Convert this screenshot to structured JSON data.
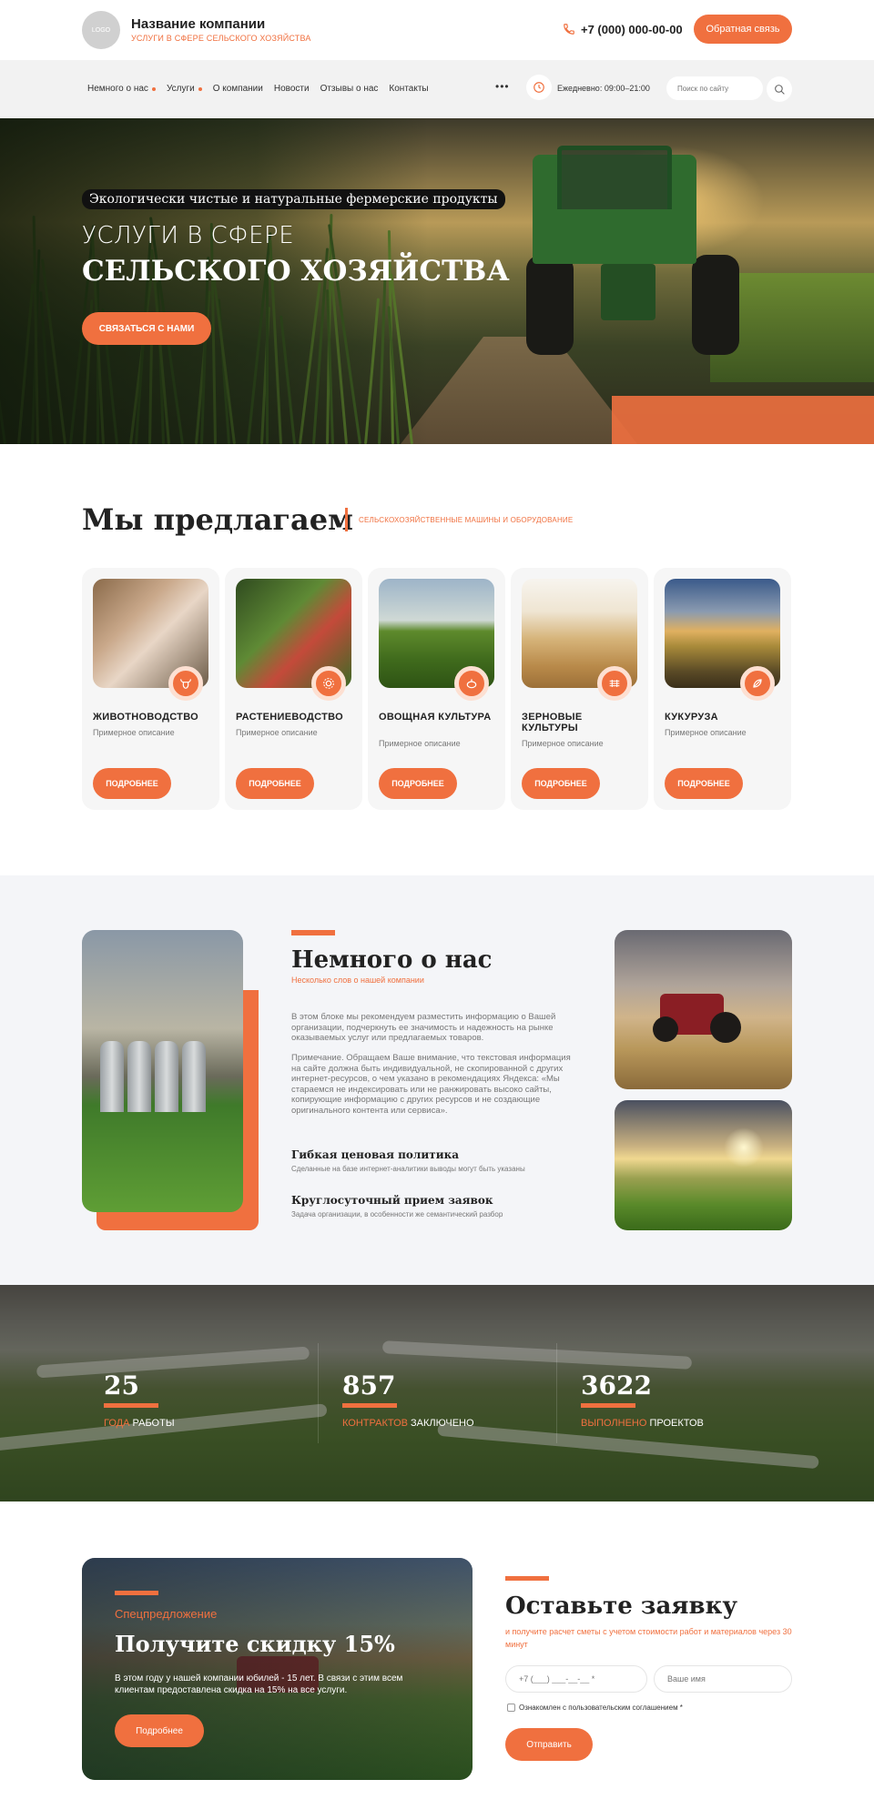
{
  "header": {
    "logo_text": "LOGO",
    "company_name": "Название компании",
    "tagline": "УСЛУГИ В СФЕРЕ СЕЛЬСКОГО ХОЗЯЙСТВА",
    "phone": "+7 (000) 000-00-00",
    "callback_label": "Обратная связь"
  },
  "nav": {
    "items": [
      {
        "label": "Немного о нас",
        "has_dropdown": true
      },
      {
        "label": "Услуги",
        "has_dropdown": true
      },
      {
        "label": "О компании",
        "has_dropdown": false
      },
      {
        "label": "Новости",
        "has_dropdown": false
      },
      {
        "label": "Отзывы о нас",
        "has_dropdown": false
      },
      {
        "label": "Контакты",
        "has_dropdown": false
      }
    ],
    "more": "•••",
    "hours": "Ежедневно: 09:00–21:00",
    "search_placeholder": "Поиск по сайту"
  },
  "hero": {
    "label": "Экологически чистые и натуральные фермерские продукты",
    "title_line1": "УСЛУГИ В СФЕРЕ",
    "title_line2": "СЕЛЬСКОГО ХОЗЯЙСТВА",
    "button": "СВЯЗАТЬСЯ С НАМИ"
  },
  "offers": {
    "title": "Мы предлагаем",
    "subtitle": "СЕЛЬСКОХОЗЯЙСТВЕННЫЕ МАШИНЫ И ОБОРУДОВАНИЕ",
    "items": [
      {
        "name": "ЖИВОТНОВОДСТВО",
        "desc": "Примерное описание",
        "button": "ПОДРОБНЕЕ",
        "icon": "bull-icon"
      },
      {
        "name": "РАСТЕНИЕВОДСТВО",
        "desc": "Примерное описание",
        "button": "ПОДРОБНЕЕ",
        "icon": "sunflower-icon"
      },
      {
        "name": "ОВОЩНАЯ КУЛЬТУРА",
        "desc": "Примерное описание",
        "button": "ПОДРОБНЕЕ",
        "icon": "vegetable-icon"
      },
      {
        "name": "ЗЕРНОВЫЕ КУЛЬТУРЫ",
        "desc": "Примерное описание",
        "button": "ПОДРОБНЕЕ",
        "icon": "grain-icon"
      },
      {
        "name": "КУКУРУЗА",
        "desc": "Примерное описание",
        "button": "ПОДРОБНЕЕ",
        "icon": "corn-icon"
      }
    ]
  },
  "about": {
    "title": "Немного о нас",
    "subtitle": "Несколько слов о нашей компании",
    "paragraph1": "В этом блоке мы рекомендуем разместить информацию о Вашей организации, подчеркнуть ее значимость и надежность на рынке оказываемых услуг или предлагаемых товаров.",
    "paragraph2": "Примечание. Обращаем Ваше внимание, что текстовая информация на сайте должна быть индивидуальной, не скопированной с других интернет-ресурсов, о чем указано в рекомендациях Яндекса: «Мы стараемся не индексировать или не ранжировать высоко сайты, копирующие информацию с других ресурсов и не создающие оригинального контента или сервиса».",
    "features": [
      {
        "title": "Гибкая ценовая политика",
        "desc": "Сделанные на базе интернет-аналитики выводы могут быть указаны"
      },
      {
        "title": "Круглосуточный прием заявок",
        "desc": "Задача организации, в особенности же семантический разбор"
      }
    ]
  },
  "stats": [
    {
      "value": "25",
      "label_hl": "ГОДА",
      "label_rest": " РАБОТЫ"
    },
    {
      "value": "857",
      "label_hl": "КОНТРАКТОВ",
      "label_rest": " ЗАКЛЮЧЕНО"
    },
    {
      "value": "3622",
      "label_hl": "ВЫПОЛНЕНО",
      "label_rest": " ПРОЕКТОВ"
    }
  ],
  "promo": {
    "kicker": "Спецпредложение",
    "title": "Получите скидку 15%",
    "text": "В этом году у нашей компании юбилей - 15 лет. В связи с этим всем клиентам предоставлена скидка на 15% на все услуги.",
    "button": "Подробнее"
  },
  "form": {
    "title": "Оставьте заявку",
    "subtitle": "и получите расчет сметы с учетом стоимости работ и материалов через 30 минут",
    "phone_placeholder": "+7 (___) ___-__-__ *",
    "name_placeholder": "Ваше имя",
    "agreement": "Ознакомлен с пользовательским соглашением *",
    "submit": "Отправить"
  },
  "colors": {
    "accent": "#f0703f",
    "section_bg": "#f4f5f8"
  }
}
